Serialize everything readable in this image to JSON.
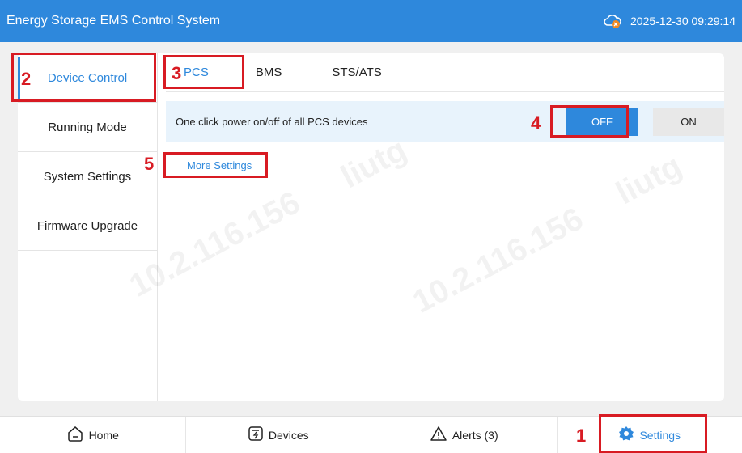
{
  "header": {
    "title": "Energy Storage EMS Control System",
    "datetime": "2025-12-30 09:29:14",
    "status_icon": "cloud-disconnected-icon"
  },
  "sidebar": {
    "items": [
      {
        "label": "Device Control",
        "active": true
      },
      {
        "label": "Running Mode",
        "active": false
      },
      {
        "label": "System Settings",
        "active": false
      },
      {
        "label": "Firmware Upgrade",
        "active": false
      }
    ]
  },
  "tabs": [
    {
      "label": "PCS",
      "active": true
    },
    {
      "label": "BMS",
      "active": false
    },
    {
      "label": "STS/ATS",
      "active": false
    }
  ],
  "power_row": {
    "label": "One click power on/off of all PCS devices",
    "off_label": "OFF",
    "on_label": "ON",
    "selected": "OFF"
  },
  "more_settings_label": "More Settings",
  "bottom_nav": {
    "items": [
      {
        "label": "Home",
        "icon": "home-icon"
      },
      {
        "label": "Devices",
        "icon": "devices-icon"
      },
      {
        "label": "Alerts (3)",
        "icon": "alert-icon"
      },
      {
        "label": "Settings",
        "icon": "gear-icon",
        "active": true
      }
    ]
  },
  "annotations": [
    "1",
    "2",
    "3",
    "4",
    "5"
  ],
  "watermark": {
    "lines": [
      "10.2.116.156",
      "liutg"
    ]
  },
  "colors": {
    "accent": "#2e88dc",
    "annotation": "#d81b23",
    "row_bg": "#e8f3fc"
  }
}
